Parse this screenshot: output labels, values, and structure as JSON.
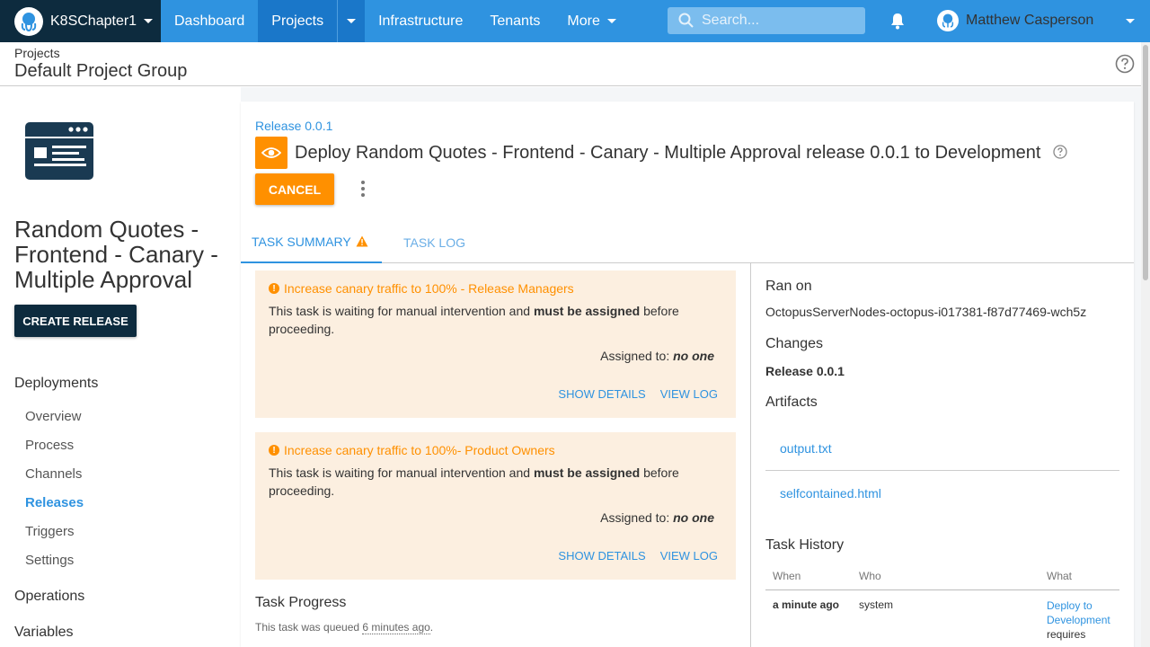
{
  "nav": {
    "space_name": "K8SChapter1",
    "items": [
      {
        "label": "Dashboard"
      },
      {
        "label": "Projects"
      },
      {
        "label": "Infrastructure"
      },
      {
        "label": "Tenants"
      },
      {
        "label": "More"
      }
    ],
    "search_placeholder": "Search...",
    "user_name": "Matthew Casperson"
  },
  "header": {
    "breadcrumb": "Projects",
    "title": "Default Project Group"
  },
  "sidebar": {
    "project_name": "Random Quotes - Frontend - Canary - Multiple Approval",
    "create_release": "CREATE RELEASE",
    "deployments_heading": "Deployments",
    "links": [
      {
        "label": "Overview"
      },
      {
        "label": "Process"
      },
      {
        "label": "Channels"
      },
      {
        "label": "Releases"
      },
      {
        "label": "Triggers"
      },
      {
        "label": "Settings"
      }
    ],
    "operations_heading": "Operations",
    "variables_heading": "Variables"
  },
  "task": {
    "release_link": "Release 0.0.1",
    "title": "Deploy Random Quotes - Frontend - Canary - Multiple Approval release 0.0.1 to Development",
    "cancel_label": "CANCEL",
    "tabs": [
      {
        "label": "TASK SUMMARY"
      },
      {
        "label": "TASK LOG"
      }
    ]
  },
  "interventions": [
    {
      "title": "Increase canary traffic to 100% - Release Managers",
      "body_pre": "This task is waiting for manual intervention and ",
      "body_bold": "must be assigned",
      "body_post": " before proceeding.",
      "assigned_label": "Assigned to: ",
      "assigned_value": "no one",
      "show_details": "SHOW DETAILS",
      "view_log": "VIEW LOG"
    },
    {
      "title": "Increase canary traffic to 100%- Product Owners",
      "body_pre": "This task is waiting for manual intervention and ",
      "body_bold": "must be assigned",
      "body_post": " before proceeding.",
      "assigned_label": "Assigned to: ",
      "assigned_value": "no one",
      "show_details": "SHOW DETAILS",
      "view_log": "VIEW LOG"
    }
  ],
  "progress": {
    "heading": "Task Progress",
    "queued_pre": "This task was queued ",
    "queued_time": "6 minutes ago",
    "queued_post": "."
  },
  "details": {
    "ran_on_heading": "Ran on",
    "ran_on_value": "OctopusServerNodes-octopus-i017381-f87d77469-wch5z",
    "changes_heading": "Changes",
    "changes_value": "Release 0.0.1",
    "artifacts_heading": "Artifacts",
    "artifacts": [
      "output.txt",
      "selfcontained.html"
    ],
    "history_heading": "Task History",
    "history_columns": [
      "When",
      "Who",
      "What"
    ],
    "history_rows": [
      {
        "when": "a minute ago",
        "who": "system",
        "what_link": "Deploy to Development",
        "what_text": "requires"
      }
    ]
  },
  "colors": {
    "nav_blue": "#2f93e0",
    "nav_dark": "#0d2b3e",
    "accent_orange": "#ff9000",
    "intervention_bg": "#fcefe0"
  },
  "icons": [
    "octopus-logo-icon",
    "chevron-down-icon",
    "search-icon",
    "bell-icon",
    "user-avatar-icon",
    "help-circle-icon",
    "project-logo-icon",
    "eye-icon",
    "kebab-menu-icon",
    "warning-triangle-icon",
    "warning-circle-icon"
  ]
}
